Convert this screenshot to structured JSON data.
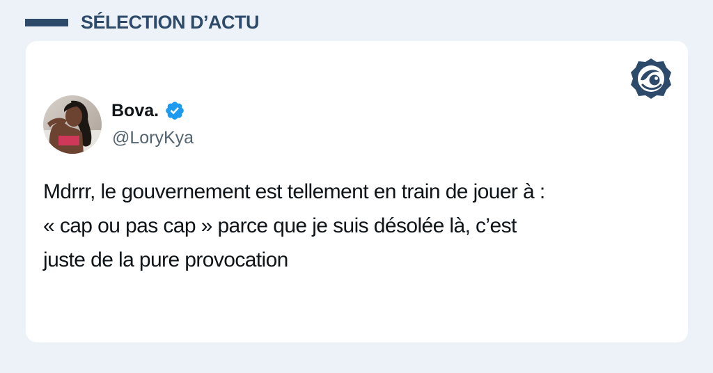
{
  "header": {
    "label": "SÉLECTION D’ACTU"
  },
  "colors": {
    "background": "#ecf2f8",
    "header_accent": "#2d4a6a",
    "card": "#ffffff",
    "verified": "#1d9bf0",
    "handle_gray": "#536471",
    "text": "#0f1419"
  },
  "tweet": {
    "author_name": "Bova.",
    "author_handle": "@LoryKya",
    "verified": true,
    "text_lines": [
      "Mdrrr, le gouvernement est tellement en train de jouer à  :",
      "« cap ou pas cap » parce que je suis désolée là, c’est",
      "juste de la pure provocation"
    ]
  },
  "icons": {
    "brand_logo": "brand-eye-logo-icon",
    "verified": "verified-badge-icon"
  }
}
